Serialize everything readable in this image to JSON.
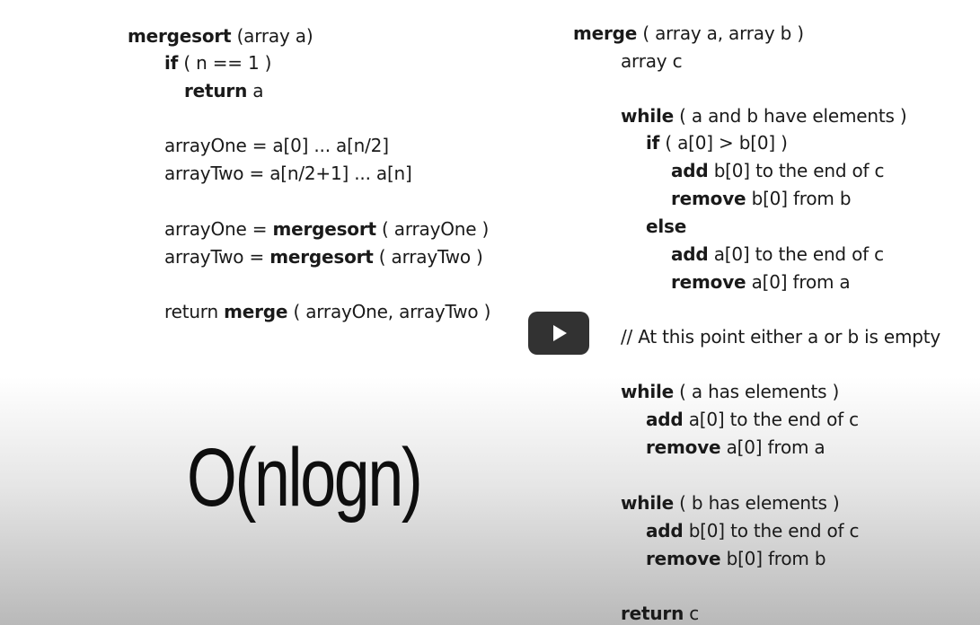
{
  "left_code": [
    [
      {
        "t": "mergesort",
        "b": true
      },
      {
        "t": " (array a)",
        "b": false
      }
    ],
    [
      {
        "t": "if",
        "b": true
      },
      {
        "t": " ( n == 1 )",
        "b": false
      }
    ],
    [
      {
        "t": "return",
        "b": true
      },
      {
        "t": " a",
        "b": false
      }
    ],
    [
      {
        "t": "arrayOne = a[0] ... a[n/2]",
        "b": false
      }
    ],
    [
      {
        "t": "arrayTwo = a[n/2+1] ... a[n]",
        "b": false
      }
    ],
    [
      {
        "t": "arrayOne = ",
        "b": false
      },
      {
        "t": "mergesort",
        "b": true
      },
      {
        "t": " ( arrayOne )",
        "b": false
      }
    ],
    [
      {
        "t": "arrayTwo = ",
        "b": false
      },
      {
        "t": "mergesort",
        "b": true
      },
      {
        "t": " ( arrayTwo )",
        "b": false
      }
    ],
    [
      {
        "t": "return ",
        "b": false
      },
      {
        "t": "merge",
        "b": true
      },
      {
        "t": " ( arrayOne, arrayTwo )",
        "b": false
      }
    ]
  ],
  "right_code": [
    [
      {
        "t": "merge",
        "b": true
      },
      {
        "t": " ( array a, array b )",
        "b": false
      }
    ],
    [
      {
        "t": "array c",
        "b": false
      }
    ],
    [
      {
        "t": "while",
        "b": true
      },
      {
        "t": " ( a and b have elements )",
        "b": false
      }
    ],
    [
      {
        "t": "if",
        "b": true
      },
      {
        "t": " ( a[0] > b[0] )",
        "b": false
      }
    ],
    [
      {
        "t": "add",
        "b": true
      },
      {
        "t": " b[0] to the end of c",
        "b": false
      }
    ],
    [
      {
        "t": "remove",
        "b": true
      },
      {
        "t": " b[0] from b",
        "b": false
      }
    ],
    [
      {
        "t": "else",
        "b": true
      }
    ],
    [
      {
        "t": "add",
        "b": true
      },
      {
        "t": " a[0] to the end of c",
        "b": false
      }
    ],
    [
      {
        "t": "remove",
        "b": true
      },
      {
        "t": " a[0] from a",
        "b": false
      }
    ],
    [
      {
        "t": "// At this point either a or b is empty",
        "b": false
      }
    ],
    [
      {
        "t": "while",
        "b": true
      },
      {
        "t": " ( a has elements )",
        "b": false
      }
    ],
    [
      {
        "t": "add",
        "b": true
      },
      {
        "t": " a[0] to the end of c",
        "b": false
      }
    ],
    [
      {
        "t": "remove",
        "b": true
      },
      {
        "t": " a[0] from a",
        "b": false
      }
    ],
    [
      {
        "t": "while",
        "b": true
      },
      {
        "t": " ( b has elements )",
        "b": false
      }
    ],
    [
      {
        "t": "add",
        "b": true
      },
      {
        "t": " b[0] to the end of c",
        "b": false
      }
    ],
    [
      {
        "t": "remove",
        "b": true
      },
      {
        "t": " b[0] from b",
        "b": false
      }
    ],
    [
      {
        "t": "return",
        "b": true
      },
      {
        "t": " c",
        "b": false
      }
    ]
  ],
  "complexity_label": "O(nlogn)",
  "play_button": {
    "icon": "play-icon",
    "color": "#212121"
  }
}
